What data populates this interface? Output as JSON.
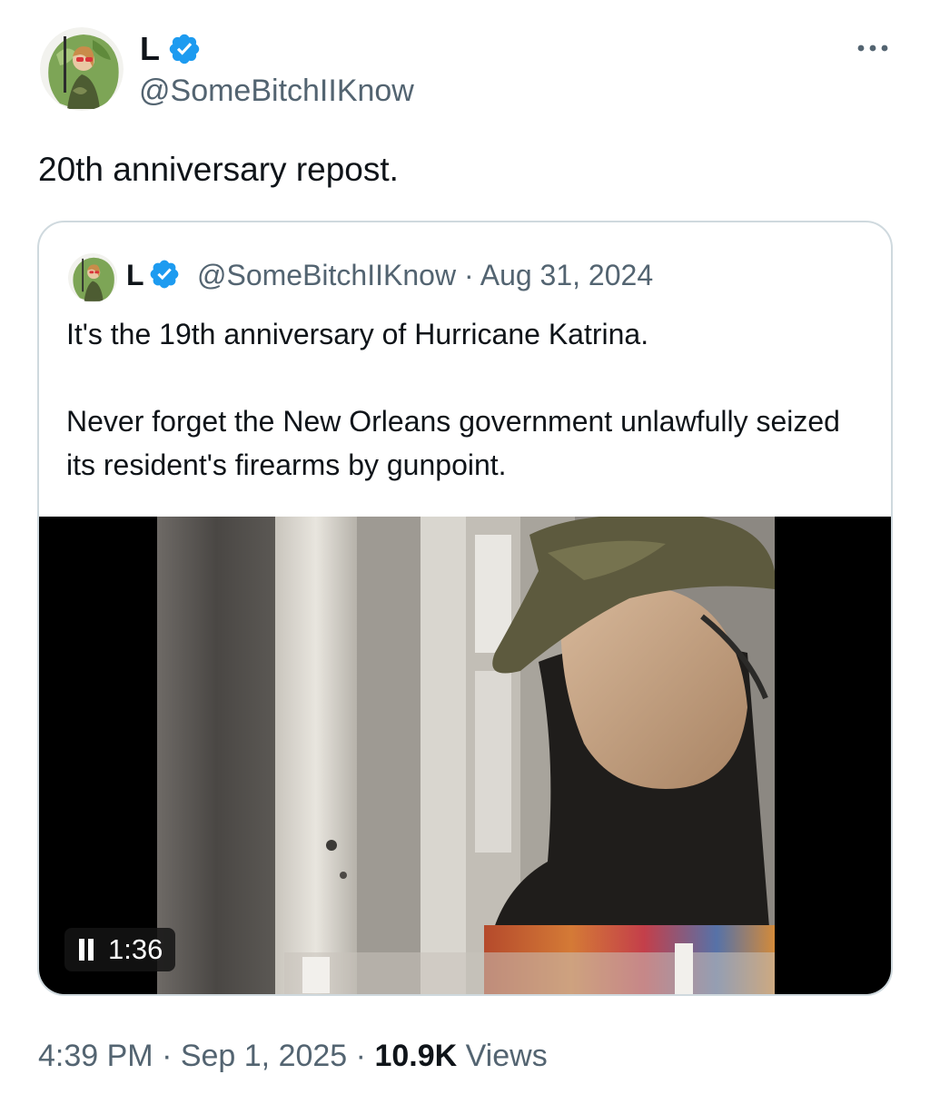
{
  "post": {
    "author_name": "L",
    "author_handle": "@SomeBitchIIKnow",
    "text": "20th anniversary repost.",
    "timestamp": "4:39 PM · Sep 1, 2025 · ",
    "views_count": "10.9K",
    "views_label": " Views"
  },
  "quote": {
    "author_name": "L",
    "author_handle": "@SomeBitchIIKnow",
    "separator": " · ",
    "date": "Aug 31, 2024",
    "paragraphs": [
      "It's the 19th anniversary of Hurricane Katrina.",
      "Never forget the New Orleans government unlawfully seized its resident's firearms by gunpoint."
    ],
    "video_duration": "1:36"
  },
  "colors": {
    "verified": "#1d9bf0",
    "secondary_text": "#536471",
    "border": "#cfd9de"
  },
  "icons": {
    "verified": "verified-badge-icon",
    "more": "more-horizontal-icon",
    "pause": "pause-icon"
  }
}
